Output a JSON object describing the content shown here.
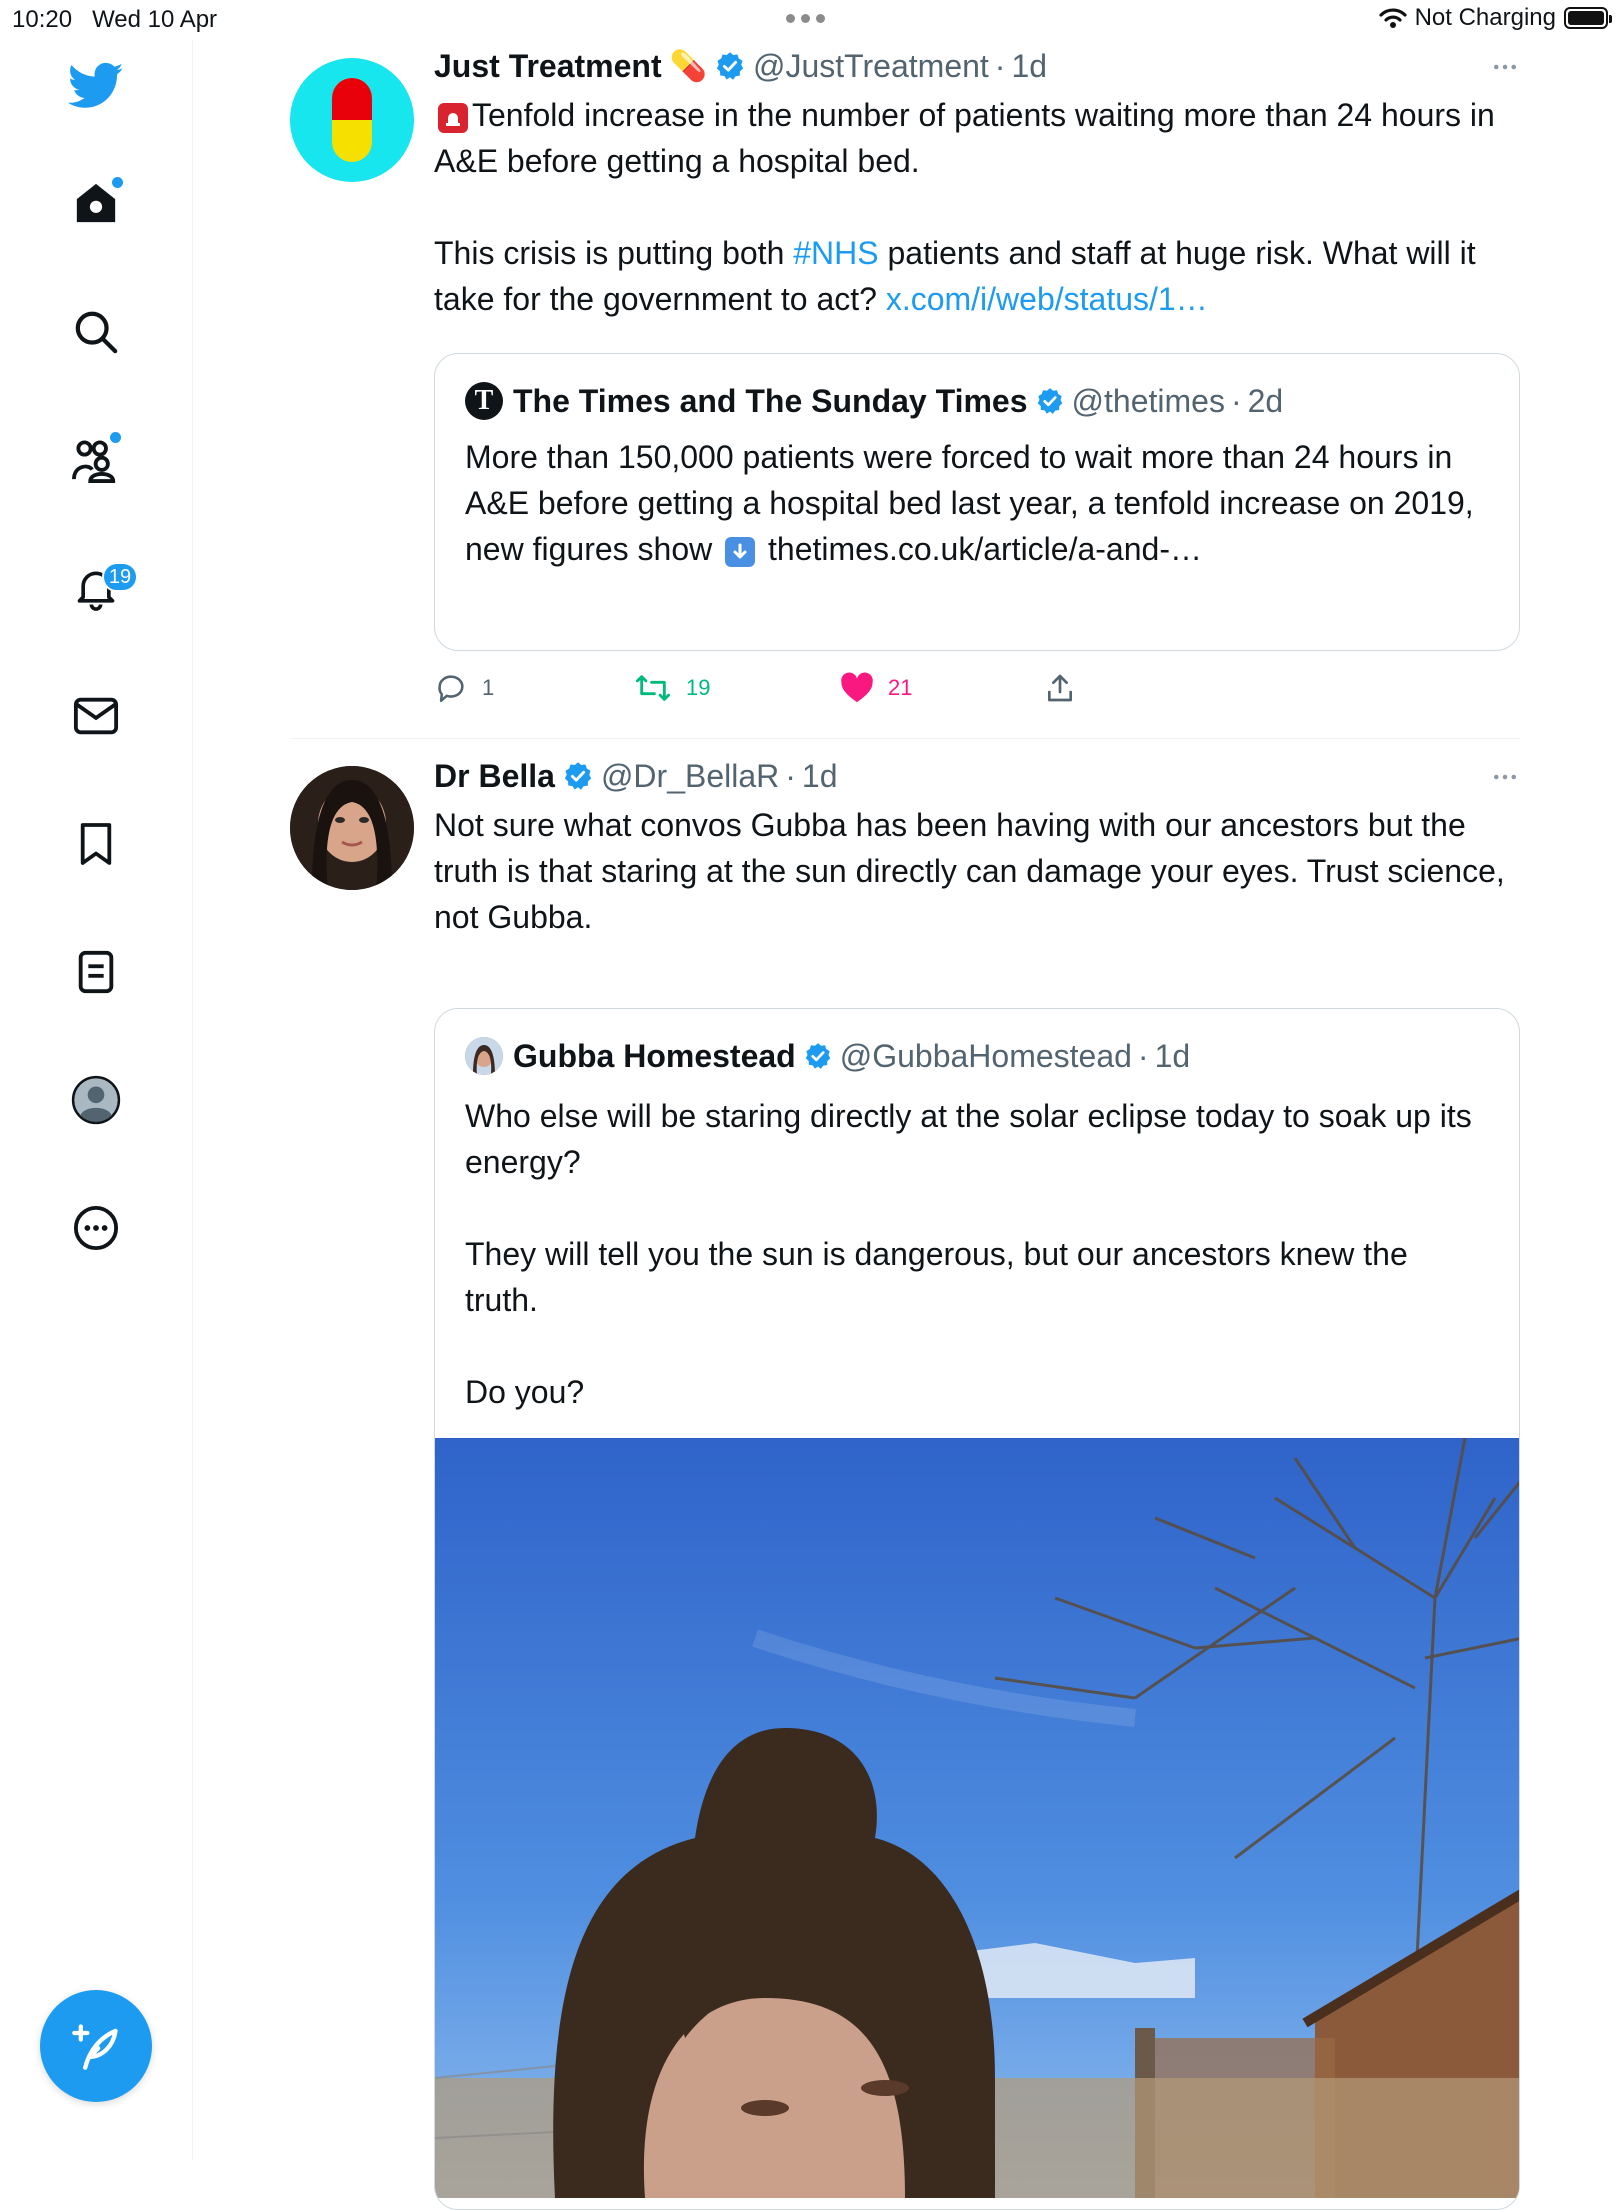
{
  "status_bar": {
    "time": "10:20",
    "date": "Wed 10 Apr",
    "battery_text": "Not Charging"
  },
  "sidebar": {
    "items": [
      {
        "name": "home",
        "icon": "home-icon"
      },
      {
        "name": "explore",
        "icon": "search-icon"
      },
      {
        "name": "communities",
        "icon": "communities-icon"
      },
      {
        "name": "notifications",
        "icon": "bell-icon",
        "badge": "19"
      },
      {
        "name": "messages",
        "icon": "envelope-icon"
      },
      {
        "name": "bookmarks",
        "icon": "bookmark-icon"
      },
      {
        "name": "lists",
        "icon": "list-icon"
      },
      {
        "name": "profile",
        "icon": "profile-icon"
      },
      {
        "name": "more",
        "icon": "more-circle-icon"
      }
    ],
    "accent": "#1d9bf0"
  },
  "tweets": [
    {
      "name": "Just Treatment",
      "handle": "@JustTreatment",
      "sep": "·",
      "time": "1d",
      "text_p1": "Tenfold increase in the number of patients waiting more than 24 hours in A&E before getting a hospital bed.",
      "text_p2_a": "This crisis is putting both ",
      "hashtag": "#NHS",
      "text_p2_b": " patients and staff at huge risk. What will it take for the government to act? ",
      "link": "x.com/i/web/status/1…",
      "quote": {
        "name": "The Times and The Sunday Times",
        "handle": "@thetimes",
        "sep": "·",
        "time": "2d",
        "text_a": "More than 150,000 patients were forced to wait more than 24 hours in A&E before getting a hospital bed last year, a tenfold increase on 2019, new figures show ",
        "text_b": " thetimes.co.uk/article/a-and-…"
      },
      "replies": "1",
      "retweets": "19",
      "likes": "21"
    },
    {
      "name": "Dr Bella",
      "handle": "@Dr_BellaR",
      "sep": "·",
      "time": "1d",
      "text": "Not sure what convos Gubba has been having with our ancestors but the truth is that staring at the sun directly can damage your eyes. Trust science, not Gubba.",
      "quote": {
        "name": "Gubba Homestead",
        "handle": "@GubbaHomestead",
        "sep": "·",
        "time": "1d",
        "p1": "Who else will be staring directly at the solar eclipse today to soak up its energy?",
        "p2": "They will tell you the sun is dangerous, but our ancestors knew the truth.",
        "p3": "Do you?"
      }
    }
  ],
  "colors": {
    "retweet": "#00ba7c",
    "like": "#f91880",
    "link": "#1d9bf0",
    "secondary": "#536471"
  }
}
